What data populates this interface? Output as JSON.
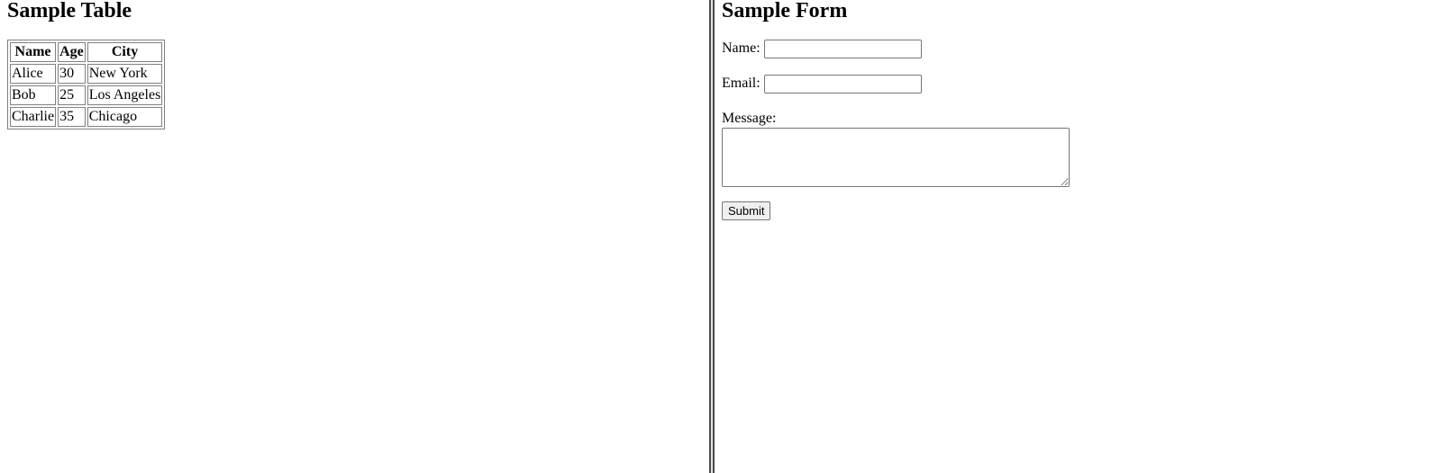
{
  "left_frame": {
    "title": "Sample Table",
    "table": {
      "headers": [
        "Name",
        "Age",
        "City"
      ],
      "rows": [
        [
          "Alice",
          "30",
          "New York"
        ],
        [
          "Bob",
          "25",
          "Los Angeles"
        ],
        [
          "Charlie",
          "35",
          "Chicago"
        ]
      ]
    }
  },
  "right_frame": {
    "title": "Sample Form",
    "form": {
      "name_label": "Name:",
      "name_value": "",
      "email_label": "Email:",
      "email_value": "",
      "message_label": "Message:",
      "message_value": "",
      "submit_label": "Submit"
    }
  },
  "colors": {
    "background": "#ffffff",
    "text": "#000000",
    "border": "#808080",
    "splitter": "#4a4a4a"
  }
}
